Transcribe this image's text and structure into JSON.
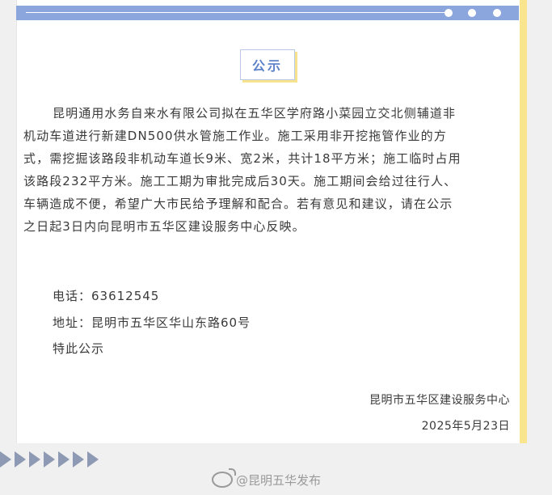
{
  "notice": {
    "title": "公示",
    "body_lines": [
      "昆明通用水务自来水有限公司拟在五华区学府路小菜园立交北侧辅道非",
      "机动车道进行新建DN500供水管施工作业。施工采用非开挖拖管作业的方",
      "式，需挖掘该路段非机动车道长9米、宽2米，共计18平方米；施工临时占用",
      "该路段232平方米。施工工期为审批完成后30天。施工期间会给过往行人、",
      "车辆造成不便，希望广大市民给予理解和配合。若有意见和建议，请在公示",
      "之日起3日内向昆明市五华区建设服务中心反映。"
    ],
    "phone": "电话：63612545",
    "address": "地址：昆明市五华区华山东路60号",
    "closing": "特此公示",
    "org": "昆明市五华区建设服务中心",
    "date": "2025年5月23日"
  },
  "watermark": {
    "text": "@昆明五华发布",
    "icon": "weibo-icon"
  },
  "colors": {
    "accent": "#8aa6dc",
    "title": "#5d82c9",
    "highlight": "#f7e28d"
  }
}
